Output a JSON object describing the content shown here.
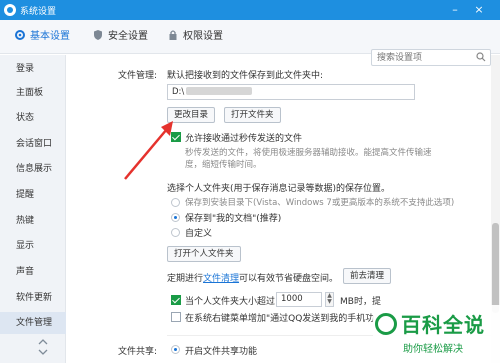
{
  "window": {
    "title": "系统设置"
  },
  "tabs": [
    {
      "label": "基本设置",
      "icon": "gear-icon"
    },
    {
      "label": "安全设置",
      "icon": "shield-icon"
    },
    {
      "label": "权限设置",
      "icon": "lock-icon"
    }
  ],
  "search": {
    "placeholder": "搜索设置项"
  },
  "sidebar": {
    "items": [
      {
        "label": "登录"
      },
      {
        "label": "主面板"
      },
      {
        "label": "状态"
      },
      {
        "label": "会话窗口"
      },
      {
        "label": "信息展示"
      },
      {
        "label": "提醒"
      },
      {
        "label": "热键"
      },
      {
        "label": "显示"
      },
      {
        "label": "声音"
      },
      {
        "label": "软件更新"
      },
      {
        "label": "文件管理"
      }
    ],
    "active": "文件管理"
  },
  "file_mgmt": {
    "section_label": "文件管理:",
    "default_save_text": "默认把接收到的文件保存到此文件夹中:",
    "path_value": "D:\\",
    "change_dir_btn": "更改目录",
    "open_folder_btn": "打开文件夹",
    "allow_instant_label": "允许接收通过秒传发送的文件",
    "allow_instant_checked": true,
    "instant_desc_1": "秒传发送的文件，将使用极速服务器辅助接收。能提高文件传输速",
    "instant_desc_2": "度，缩短传输时间。",
    "personal_folder_title": "选择个人文件夹(用于保存消息记录等数据)的保存位置。",
    "radio_options": [
      {
        "label": "保存到安装目录下(Vista、Windows 7或更高版本的系统不支持此选项)",
        "selected": false,
        "disabled": true
      },
      {
        "label": "保存到\"我的文档\"(推荐)",
        "selected": true,
        "disabled": false
      },
      {
        "label": "自定义",
        "selected": false,
        "disabled": false
      }
    ],
    "open_personal_btn": "打开个人文件夹",
    "cleanup_prefix": "定期进行",
    "cleanup_link": "文件清理",
    "cleanup_suffix": "可以有效节省硬盘空间。",
    "cleanup_btn": "前去清理",
    "size_limit_label": "当个人文件夹大小超过",
    "size_limit_value": "1000",
    "size_limit_unit": "MB时，提",
    "size_limit_checked": true,
    "right_menu_label": "在系统右键菜单增加\"通过QQ发送到我的手机功",
    "right_menu_checked": false
  },
  "file_share": {
    "section_label": "文件共享:",
    "option_label": "开启文件共享功能",
    "option_selected": true
  },
  "watermark": {
    "title": "百科全说",
    "subtitle": "助你轻松解决"
  }
}
